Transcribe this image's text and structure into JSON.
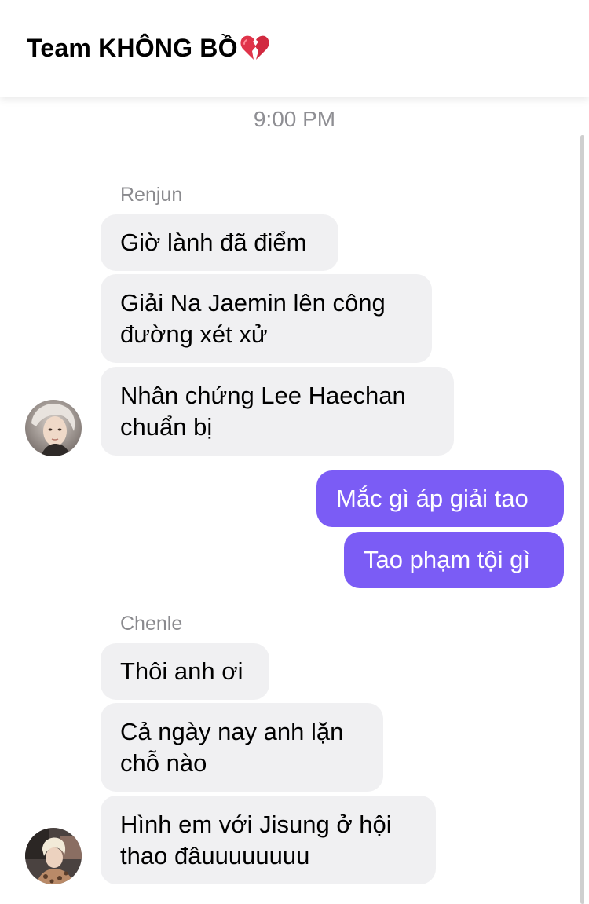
{
  "header": {
    "title": "Team KHÔNG BỒ",
    "title_emoji": "broken-heart-icon"
  },
  "chat": {
    "timestamp": "9:00 PM",
    "groups": [
      {
        "sender": "Renjun",
        "avatar": "renjun-avatar",
        "messages": [
          "Giờ lành đã điểm",
          "Giải Na Jaemin lên công đường xét xử",
          "Nhân chứng Lee Haechan chuẩn bị"
        ]
      },
      {
        "sender": "",
        "outgoing": true,
        "messages": [
          "Mắc gì áp giải tao",
          "Tao phạm tội gì"
        ]
      },
      {
        "sender": "Chenle",
        "avatar": "chenle-avatar",
        "messages": [
          "Thôi anh ơi",
          "Cả ngày nay anh lặn chỗ nào",
          "Hình em với Jisung ở hội thao đâuuuuuuuu"
        ]
      }
    ]
  },
  "colors": {
    "outgoing_bubble": "#7b5cf5",
    "incoming_bubble": "#f0f0f2",
    "meta_text": "#8e8e93"
  }
}
